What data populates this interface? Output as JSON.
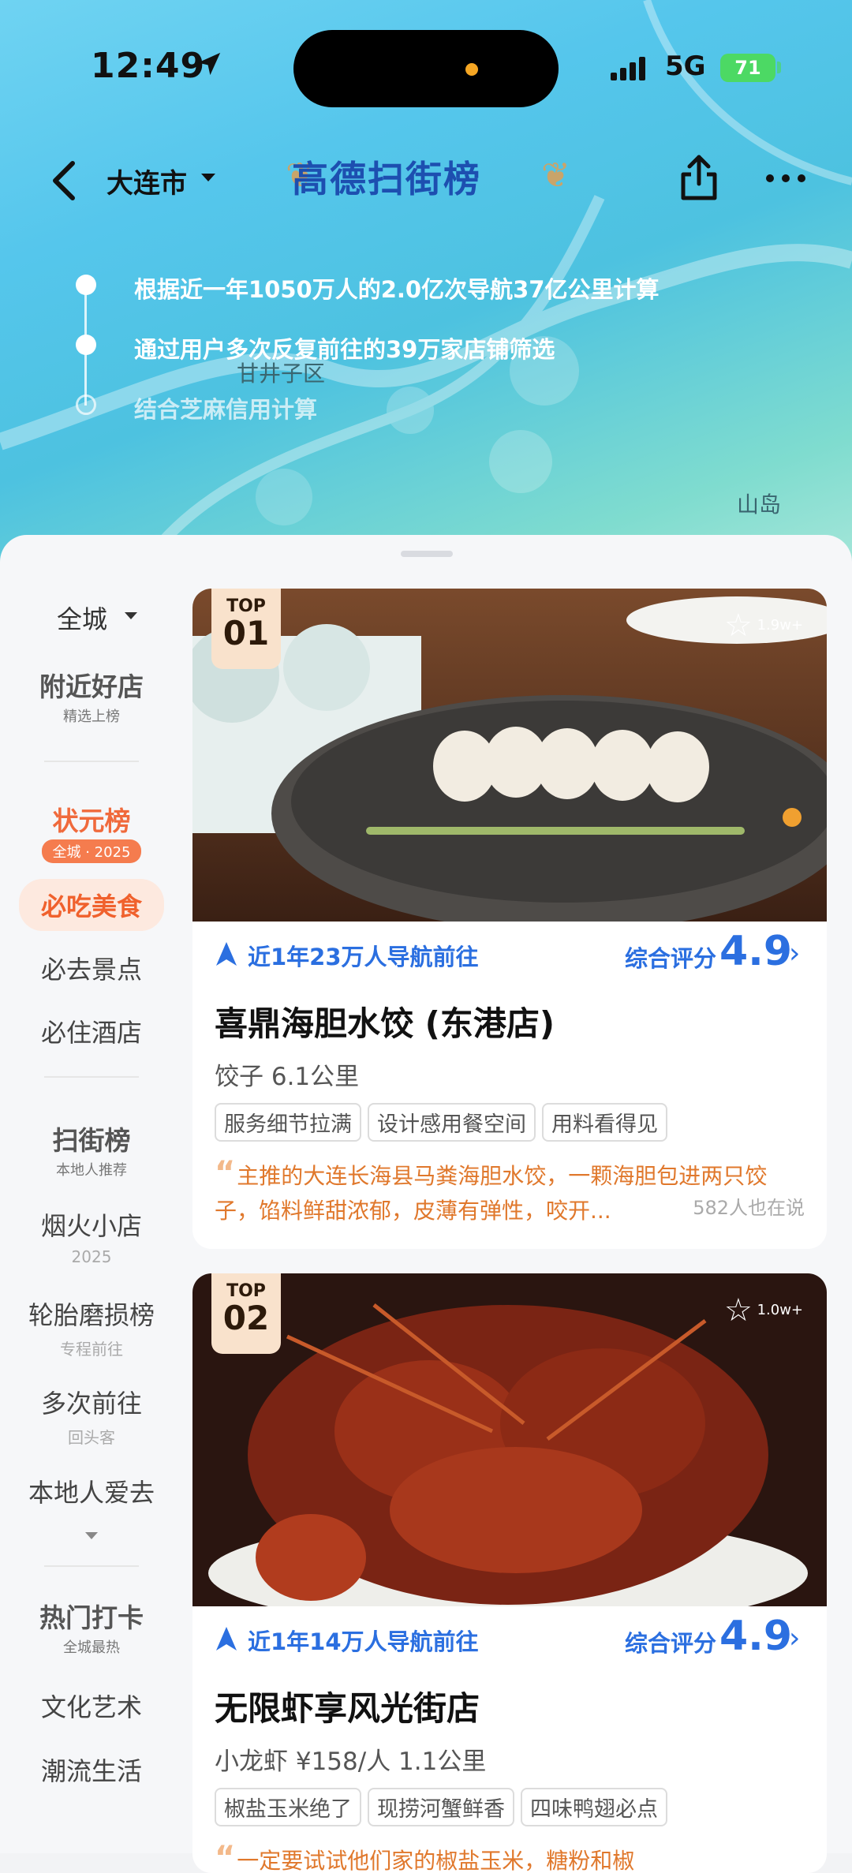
{
  "status": {
    "time": "12:49",
    "network": "5G",
    "battery": "71"
  },
  "nav": {
    "city": "大连市",
    "brand": "高德扫街榜"
  },
  "timeline": [
    "根据近一年1050万人的2.0亿次导航37亿公里计算",
    "通过用户多次反复前往的39万家店铺筛选",
    "结合芝麻信用计算"
  ],
  "map_labels": {
    "district": "甘井子区",
    "island": "山岛"
  },
  "sidebar": {
    "scope": "全城",
    "nearby": {
      "title": "附近好店",
      "sub": "精选上榜"
    },
    "champion": {
      "title": "状元榜",
      "sub": "全城 · 2025"
    },
    "items": [
      "必吃美食",
      "必去景点",
      "必住酒店"
    ],
    "street": {
      "title": "扫街榜",
      "sub": "本地人推荐"
    },
    "lists": [
      {
        "title": "烟火小店",
        "sub": "2025"
      },
      {
        "title": "轮胎磨损榜",
        "sub": "专程前往"
      },
      {
        "title": "多次前往",
        "sub": "回头客"
      },
      {
        "title": "本地人爱去",
        "sub": ""
      }
    ],
    "hot": {
      "title": "热门打卡",
      "sub": "全城最热"
    },
    "more": [
      "文化艺术",
      "潮流生活"
    ]
  },
  "cards": [
    {
      "rank_label": "TOP",
      "rank": "01",
      "favorites": "1.9w+",
      "nav_text": "近1年23万人导航前往",
      "score_label": "综合评分",
      "score": "4.9",
      "name": "喜鼎海胆水饺 (东港店)",
      "meta": "饺子  6.1公里",
      "tags": [
        "服务细节拉满",
        "设计感用餐空间",
        "用料看得见"
      ],
      "review": "主推的大连长海县马粪海胆水饺，一颗海胆包进两只饺子，馅料鲜甜浓郁，皮薄有弹性，咬开...",
      "review_count": "582人也在说"
    },
    {
      "rank_label": "TOP",
      "rank": "02",
      "favorites": "1.0w+",
      "nav_text": "近1年14万人导航前往",
      "score_label": "综合评分",
      "score": "4.9",
      "name": "无限虾享风光街店",
      "meta": "小龙虾  ¥158/人  1.1公里",
      "tags": [
        "椒盐玉米绝了",
        "现捞河蟹鲜香",
        "四味鸭翅必点"
      ],
      "review": "一定要试试他们家的椒盐玉米，糖粉和椒",
      "review_count": ""
    }
  ],
  "colors": {
    "accent_blue": "#2b6fe0",
    "accent_orange": "#f06a3c",
    "brand_blue": "#1d4fb0"
  }
}
